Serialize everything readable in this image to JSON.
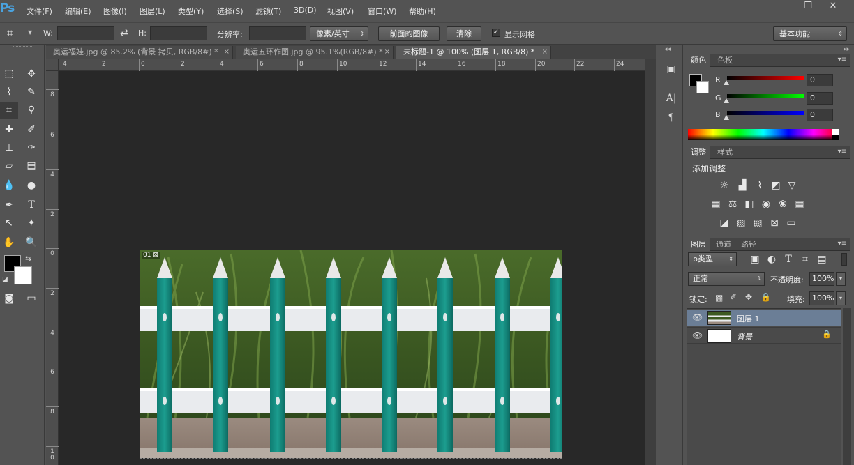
{
  "app": {
    "logo": "Ps"
  },
  "menu": {
    "items": [
      "文件(F)",
      "编辑(E)",
      "图像(I)",
      "图层(L)",
      "类型(Y)",
      "选择(S)",
      "滤镜(T)",
      "3D(D)",
      "视图(V)",
      "窗口(W)",
      "帮助(H)"
    ]
  },
  "window": {
    "minimize": "—",
    "restore": "❐",
    "close": "✕"
  },
  "options": {
    "w_label": "W:",
    "h_label": "H:",
    "resolution_label": "分辨率:",
    "unit_select": "像素/英寸",
    "front_image_button": "前面的图像",
    "clear_button": "清除",
    "show_grid_label": "显示网格",
    "show_grid_checked": true,
    "workspace_select": "基本功能"
  },
  "tabs": [
    {
      "label": "奥运福娃.jpg @ 85.2% (背景 拷贝, RGB/8#) *",
      "close": "×"
    },
    {
      "label": "奥运五环作图.jpg @ 95.1%(RGB/8#) *",
      "close": "×"
    },
    {
      "label": "未标题-1 @ 100% (图层 1, RGB/8) *",
      "close": "×"
    }
  ],
  "ruler_top_labels": [
    "4",
    "2",
    "0",
    "2",
    "4",
    "6",
    "8",
    "10",
    "12",
    "14",
    "16",
    "18",
    "20",
    "22",
    "24"
  ],
  "ruler_left_labels": [
    "8",
    "6",
    "4",
    "2",
    "0",
    "2",
    "4",
    "6",
    "8",
    "1\n0"
  ],
  "canvas": {
    "layer_badge": "01 ⊠"
  },
  "color_panel": {
    "tabs": [
      "颜色",
      "色板"
    ],
    "channels": [
      {
        "label": "R",
        "value": "0",
        "color": "#ff0000"
      },
      {
        "label": "G",
        "value": "0",
        "color": "#00ff00"
      },
      {
        "label": "B",
        "value": "0",
        "color": "#0000ff"
      }
    ],
    "foreground": "#000000",
    "background": "#ffffff"
  },
  "adjust_panel": {
    "tabs": [
      "调整",
      "样式"
    ],
    "title": "添加调整"
  },
  "layers_panel": {
    "tabs": [
      "图层",
      "通道",
      "路径"
    ],
    "filter_select": "ρ类型",
    "blend_mode": "正常",
    "opacity_label": "不透明度:",
    "opacity_value": "100%",
    "lock_label": "锁定:",
    "fill_label": "填充:",
    "fill_value": "100%",
    "layers": [
      {
        "name": "图层 1",
        "selected": true
      },
      {
        "name": "背景",
        "selected": false
      }
    ]
  },
  "colors": {
    "panel_bg": "#535353",
    "canvas_bg": "#282828",
    "selection": "#6b7e96",
    "fence_green": "#1a9185"
  }
}
